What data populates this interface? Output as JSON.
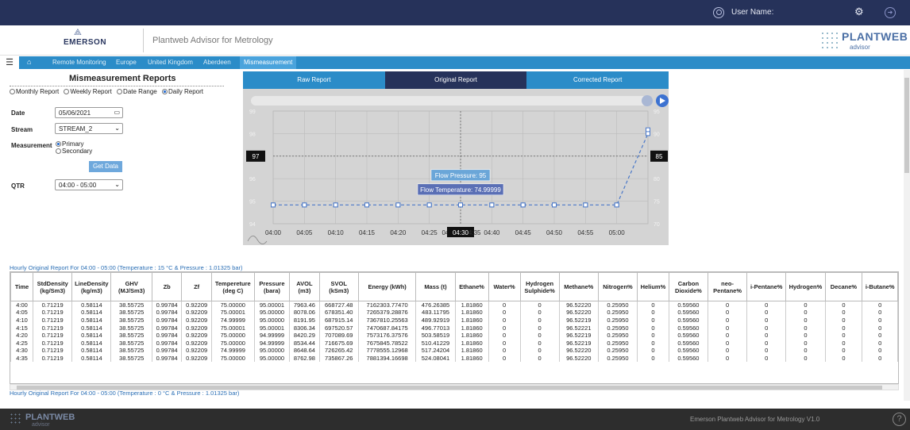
{
  "topbar": {
    "user_label": "User Name:",
    "gear_icon": "gear-icon",
    "user_icon": "user-icon",
    "logout_icon": "logout-icon"
  },
  "header": {
    "brand": "EMERSON",
    "app_title": "Plantweb Advisor for Metrology",
    "logo_main": "PLANTWEB",
    "logo_sub": "advisor"
  },
  "breadcrumb": [
    "Remote Monitoring",
    "Europe",
    "United Kingdom",
    "Aberdeen",
    "Mismeasurement"
  ],
  "form": {
    "title": "Mismeasurement Reports",
    "report_types": [
      {
        "label": "Monthly Report",
        "selected": false
      },
      {
        "label": "Weekly Report",
        "selected": false
      },
      {
        "label": "Date Range",
        "selected": false
      },
      {
        "label": "Daily Report",
        "selected": true
      }
    ],
    "date_label": "Date",
    "date_value": "05/06/2021",
    "stream_label": "Stream",
    "stream_value": "STREAM_2",
    "measurement_label": "Measurement",
    "measurement_primary": "Primary",
    "measurement_secondary": "Secondary",
    "get_data": "Get Data",
    "qtr_label": "QTR",
    "qtr_value": "04:00 - 05:00"
  },
  "tabs": [
    "Raw Report",
    "Original Report",
    "Corrected Report"
  ],
  "chart_data": {
    "type": "line",
    "x": [
      "04:00",
      "04:05",
      "04:10",
      "04:15",
      "04:20",
      "04:25",
      "04:30",
      "04:35",
      "04:40",
      "04:45",
      "04:50",
      "04:55",
      "05:00"
    ],
    "x_ticks": [
      "04:00",
      "04:05",
      "04:10",
      "04:15",
      "04:20",
      "04:25",
      "04:3",
      "04:30",
      "4:35",
      "04:40",
      "04:45",
      "04:50",
      "04:55",
      "05:00"
    ],
    "series": [
      {
        "values": [
          95,
          95,
          95,
          95,
          95,
          95,
          95,
          95,
          95,
          95,
          95,
          95,
          99
        ],
        "axis": "left",
        "ylim": [
          94,
          100
        ]
      },
      {
        "values": [
          75,
          75,
          75,
          75,
          75,
          75,
          74.99999,
          75,
          75,
          75,
          75,
          75,
          94
        ],
        "axis": "right",
        "ylim": [
          70,
          100
        ]
      }
    ],
    "y_left_ticks": [
      "99",
      "98",
      "97",
      "96",
      "95",
      "94"
    ],
    "y_right_ticks": [
      "95",
      "90",
      "85",
      "80",
      "75",
      "70"
    ],
    "crosshair_left": "97",
    "crosshair_right": "85",
    "tooltips": [
      "Flow Pressure: 95",
      "Flow Temperature: 74.99999"
    ],
    "grid": true,
    "line_color": "#4a78c8"
  },
  "tables": {
    "title1": "Hourly Original Report For 04:00 - 05:00 (Temperature : 15 °C & Pressure : 1.01325 bar)",
    "title2": "Hourly Original Report For 04:00 - 05:00 (Temperature : 0 °C & Pressure : 1.01325 bar)",
    "headers": [
      "Time",
      "StdDensity (kg/Sm3)",
      "LineDensity (kg/m3)",
      "GHV (MJ/Sm3)",
      "Zb",
      "Zf",
      "Tempereture (deg C)",
      "Pressure (bara)",
      "AVOL (m3)",
      "SVOL (kSm3)",
      "Energy (kWh)",
      "Mass (t)",
      "Ethane%",
      "Water%",
      "Hydrogen Sulphide%",
      "Methane%",
      "Nitrogen%",
      "Helium%",
      "Carbon Dioxide%",
      "neo-Pentane%",
      "i-Pentane%",
      "Hydrogen%",
      "Decane%",
      "i-Butane%"
    ],
    "rows": [
      [
        "4:00",
        "0.71219",
        "0.58114",
        "38.55725",
        "0.99784",
        "0.92209",
        "75.00000",
        "95.00001",
        "7963.46",
        "668727.48",
        "7162303.77470",
        "476.26385",
        "1.81860",
        "0",
        "0",
        "96.52220",
        "0.25950",
        "0",
        "0.59560",
        "0",
        "0",
        "0",
        "0",
        "0"
      ],
      [
        "4:05",
        "0.71219",
        "0.58114",
        "38.55725",
        "0.99784",
        "0.92209",
        "75.00001",
        "95.00000",
        "8078.06",
        "678351.40",
        "7265379.28876",
        "483.11795",
        "1.81860",
        "0",
        "0",
        "96.52220",
        "0.25950",
        "0",
        "0.59560",
        "0",
        "0",
        "0",
        "0",
        "0"
      ],
      [
        "4:10",
        "0.71219",
        "0.58114",
        "38.55725",
        "0.99784",
        "0.92209",
        "74.99999",
        "95.00000",
        "8191.95",
        "687915.14",
        "7367810.25563",
        "489.92919",
        "1.81860",
        "0",
        "0",
        "96.52219",
        "0.25950",
        "0",
        "0.59560",
        "0",
        "0",
        "0",
        "0",
        "0"
      ],
      [
        "4:15",
        "0.71219",
        "0.58114",
        "38.55725",
        "0.99784",
        "0.92209",
        "75.00001",
        "95.00001",
        "8306.34",
        "697520.57",
        "7470687.84175",
        "496.77013",
        "1.81860",
        "0",
        "0",
        "96.52221",
        "0.25950",
        "0",
        "0.59560",
        "0",
        "0",
        "0",
        "0",
        "0"
      ],
      [
        "4:20",
        "0.71219",
        "0.58114",
        "38.55725",
        "0.99784",
        "0.92209",
        "75.00000",
        "94.99999",
        "8420.29",
        "707089.69",
        "7573176.37576",
        "503.58519",
        "1.81860",
        "0",
        "0",
        "96.52219",
        "0.25950",
        "0",
        "0.59560",
        "0",
        "0",
        "0",
        "0",
        "0"
      ],
      [
        "4:25",
        "0.71219",
        "0.58114",
        "38.55725",
        "0.99784",
        "0.92209",
        "75.00000",
        "94.99999",
        "8534.44",
        "716675.69",
        "7675845.78522",
        "510.41229",
        "1.81860",
        "0",
        "0",
        "96.52219",
        "0.25950",
        "0",
        "0.59560",
        "0",
        "0",
        "0",
        "0",
        "0"
      ],
      [
        "4:30",
        "0.71219",
        "0.58114",
        "38.55725",
        "0.99784",
        "0.92209",
        "74.99999",
        "95.00000",
        "8648.64",
        "726265.42",
        "7778555.12968",
        "517.24204",
        "1.81860",
        "0",
        "0",
        "96.52220",
        "0.25950",
        "0",
        "0.59560",
        "0",
        "0",
        "0",
        "0",
        "0"
      ],
      [
        "4:35",
        "0.71219",
        "0.58114",
        "38.55725",
        "0.99784",
        "0.92209",
        "75.00000",
        "95.00000",
        "8762.98",
        "735867.26",
        "7881394.16698",
        "524.08041",
        "1.81860",
        "0",
        "0",
        "96.52220",
        "0.25950",
        "0",
        "0.59560",
        "0",
        "0",
        "0",
        "0",
        "0"
      ]
    ]
  },
  "footer": {
    "logo": "PLANTWEB",
    "logo_sub": "advisor",
    "text": "Emerson Plantweb Advisor for Metrology V1.0",
    "help_icon": "help-icon"
  }
}
